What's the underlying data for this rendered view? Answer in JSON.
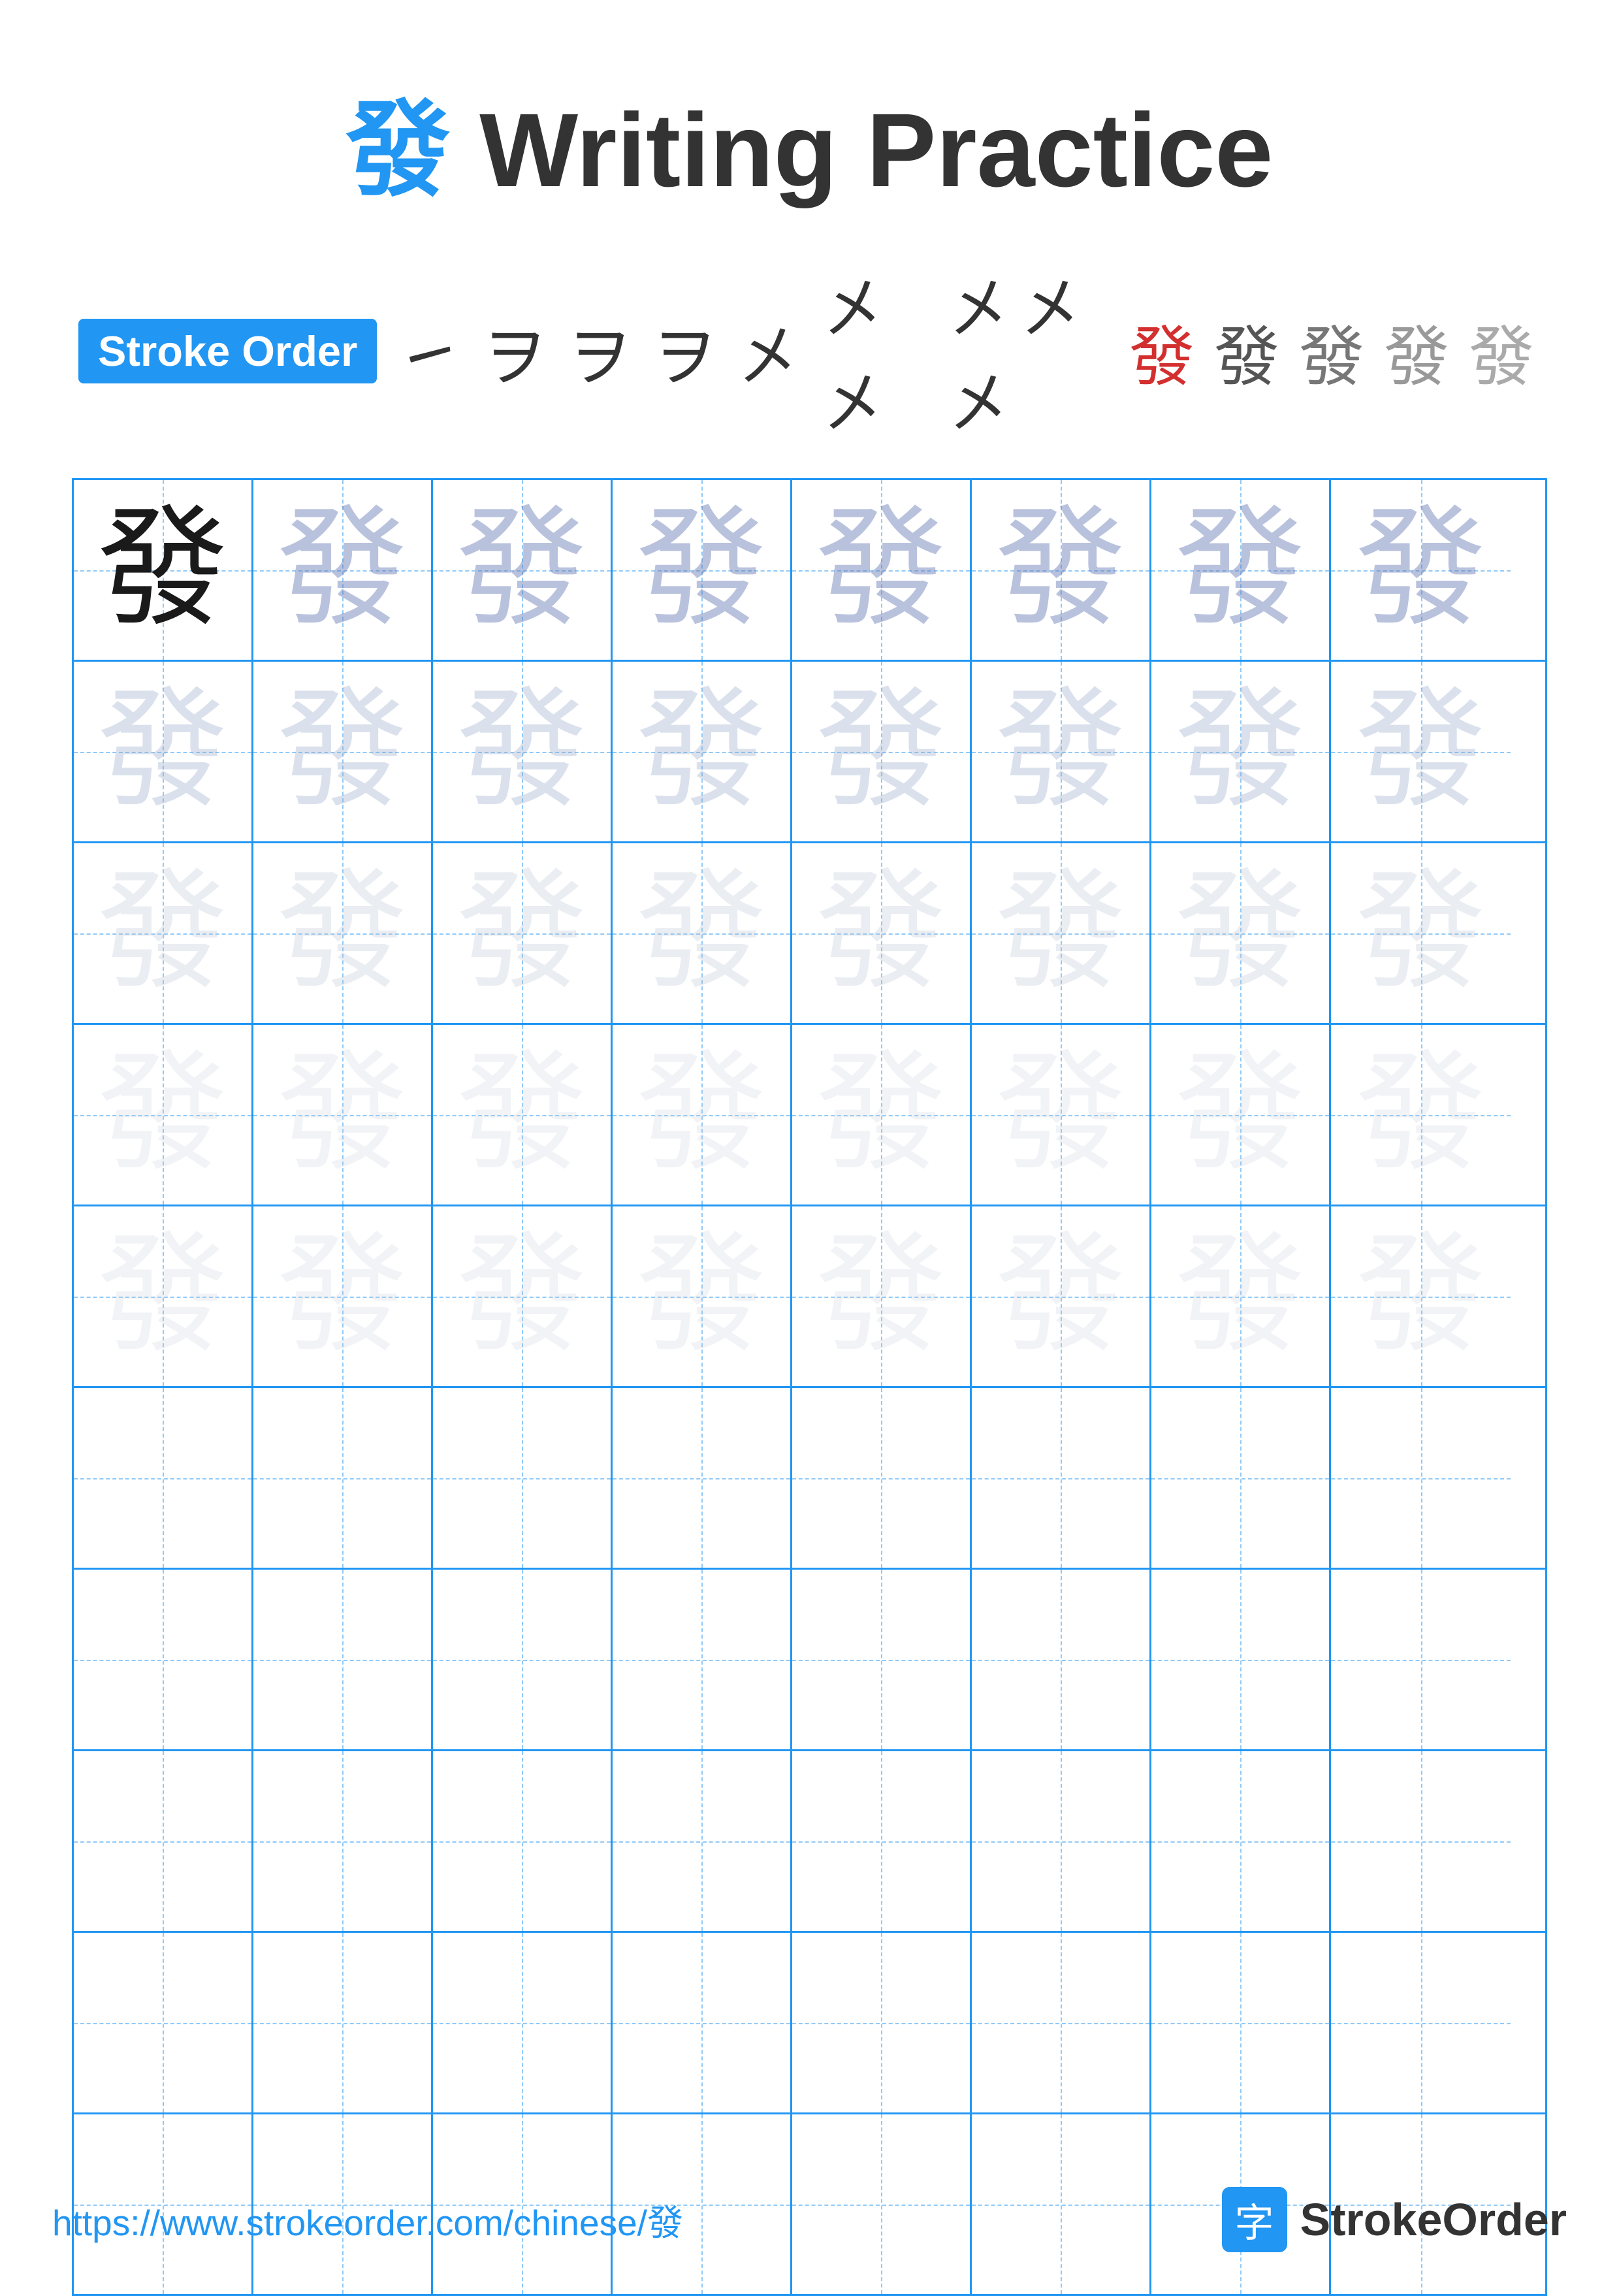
{
  "title": {
    "char": "發",
    "text": "Writing Practice",
    "full": "發 Writing Practice"
  },
  "stroke_order": {
    "badge_label": "Stroke Order",
    "sequence": [
      "㇀",
      "ヲ",
      "ヲ'",
      "ヲ''",
      "㐅乂",
      "㐅乂乂",
      "㐅乂乂乂",
      "發-7",
      "發-8",
      "發-9",
      "發-10",
      "發-11",
      "發-12"
    ]
  },
  "character": "發",
  "footer": {
    "url": "https://www.strokeorder.com/chinese/發",
    "brand": "StrokeOrder"
  },
  "grid": {
    "cols": 8,
    "practice_rows": 5,
    "empty_rows": 5
  },
  "colors": {
    "blue": "#2196F3",
    "dark": "#1a1a1a",
    "red": "#d32f2f",
    "light_blue": "#90CAF9"
  }
}
